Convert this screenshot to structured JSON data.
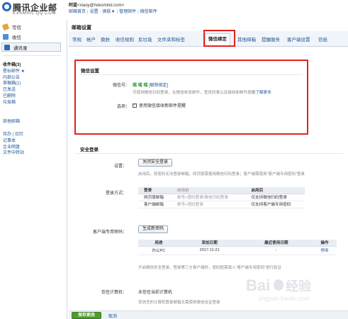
{
  "header": {
    "brand": "腾讯企业邮",
    "domain": "EXAMAIL.QQ.COM",
    "user_name": "阿蓝",
    "user_email": "<xiaoy@hokomind.com>",
    "links": [
      "邮箱首页",
      "设置",
      "换肤▼",
      "管理邮件",
      "微信邮件"
    ]
  },
  "sidebar": {
    "write": "写信",
    "inbox": "收信",
    "contacts": "通讯录",
    "folders": [
      "收件箱(3)",
      "星标邮件 ★",
      "内部公告",
      "草稿箱(1)",
      "已发送",
      "已删除",
      "垃圾箱"
    ],
    "other": "其他邮箱",
    "tools": [
      "待办 | 日历",
      "记事本",
      "企业网盘",
      "文件中转站"
    ]
  },
  "main": {
    "title": "邮箱设置",
    "tabs": [
      "常规",
      "帐户",
      "换肤",
      "收信规则",
      "反垃圾",
      "文件夹和标签",
      "微信绑定",
      "其他邮箱",
      "提醒服务",
      "客户端设置",
      "信纸"
    ],
    "active_tab": "微信绑定"
  },
  "wechat": {
    "title": "微信设置",
    "id_label": "微信号：",
    "id_value": "瑶 瑶 瑶",
    "unbind": "[解除绑定]",
    "desc": "可使用微信扫码登录，在微信收发邮件，查找同事以及接收新邮件提醒",
    "more": "了解更多",
    "option_label": "选项：",
    "option_text": "使用微信接收新邮件提醒",
    "option_checked": true
  },
  "security": {
    "title": "安全登录",
    "setting_label": "设置：",
    "close_button": "关闭安全登录",
    "setting_desc": "启用后，原密码无法登录邮箱；网页版需使用微信扫码登录；客户端需使用\"客户端专用密码\"登录",
    "method_label": "登录方式：",
    "method_table": {
      "headers": [
        "登录",
        "启用前",
        "启用后"
      ],
      "rows": [
        [
          "网页版邮箱",
          "帐号+密码登录/微信扫码登录",
          "仅支持微信扫码登录"
        ],
        [
          "客户端邮箱",
          "帐号+密码登录",
          "仅支持客户端专用密码"
        ]
      ]
    },
    "client_label": "客户端专用密码：",
    "gen_button": "生成新密码",
    "pw_table": {
      "headers": [
        "用途",
        "添加日期",
        "最近使用日期",
        "操作"
      ],
      "rows": [
        [
          "办公PC",
          "2017-11-21",
          "-",
          "停用"
        ]
      ]
    },
    "pw_desc": "开启微信安全登录，登录第三方客户端时，密码框需填入\"客户端专用密码\"进行验证",
    "trust_label": "信任计算机：",
    "trust_value": "未信任当前计算机",
    "trust_desc": "受信任的计算机登录邮箱无需使用微信验证登录"
  },
  "footer": {
    "save": "保存更改",
    "cancel": "取消"
  },
  "colors": {
    "highlight": "#e5231b",
    "link": "#1e5494",
    "save_green": "#4f9a2e"
  }
}
